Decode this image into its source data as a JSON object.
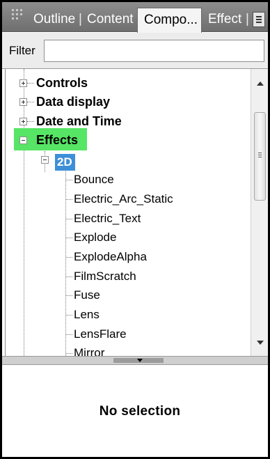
{
  "tabs": {
    "outline": "Outline",
    "content": "Content",
    "components": "Compo...",
    "effect": "Effect",
    "separator": "|"
  },
  "filter": {
    "label": "Filter",
    "value": "",
    "placeholder": ""
  },
  "tree": {
    "categories": {
      "controls": "Controls",
      "data_display": "Data display",
      "date_time": "Date and Time",
      "effects": "Effects"
    },
    "subcategory": "2D",
    "items": [
      "Bounce",
      "Electric_Arc_Static",
      "Electric_Text",
      "Explode",
      "ExplodeAlpha",
      "FilmScratch",
      "Fuse",
      "Lens",
      "LensFlare",
      "Mirror"
    ],
    "highlight_color": "#56e565",
    "selection_color": "#3d8fd8"
  },
  "properties": {
    "message": "No selection"
  },
  "icons": {
    "grip": "drag-grip-icon",
    "view_menu": "view-menu-icon",
    "expand": "plus-icon",
    "collapse": "minus-icon",
    "scroll_up": "arrow-up-icon",
    "scroll_down": "arrow-down-icon",
    "splitter": "arrow-down-icon"
  }
}
